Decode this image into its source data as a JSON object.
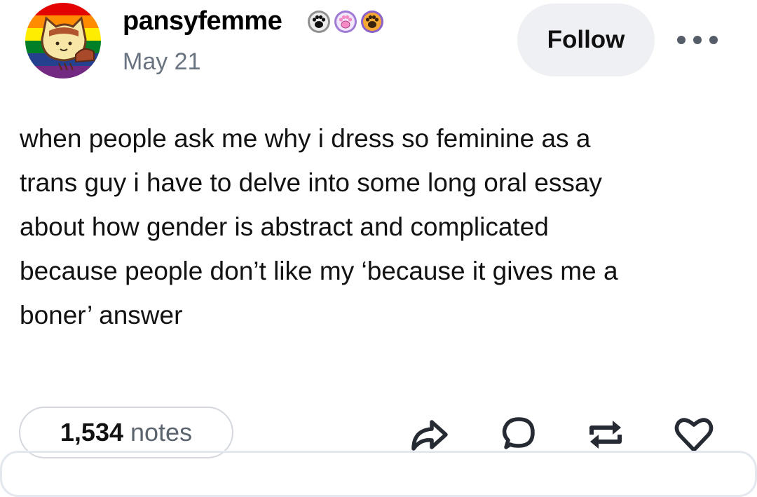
{
  "author": {
    "username": "pansyfemme",
    "date": "May 21",
    "badges": [
      "black-paw-badge-icon",
      "pink-paw-badge-icon",
      "orange-paw-badge-icon"
    ],
    "avatar_icon": "pride-flag-cat-avatar"
  },
  "header": {
    "follow_label": "Follow",
    "more_icon": "more-options-icon"
  },
  "post": {
    "lines": [
      "when people ask me why i dress so feminine as a",
      "trans guy i have to delve into some long oral essay",
      "about how gender is abstract and complicated",
      "because people don’t like my ‘because it gives me a",
      "boner’ answer"
    ]
  },
  "footer": {
    "notes_count": "1,534",
    "notes_label": "notes",
    "actions": [
      "share-icon",
      "reply-icon",
      "reblog-icon",
      "like-icon"
    ]
  },
  "colors": {
    "follow_bg": "#eef0f3",
    "date_gray": "#6a7380",
    "icon_dark": "#252a33",
    "border": "#d4d8de"
  }
}
